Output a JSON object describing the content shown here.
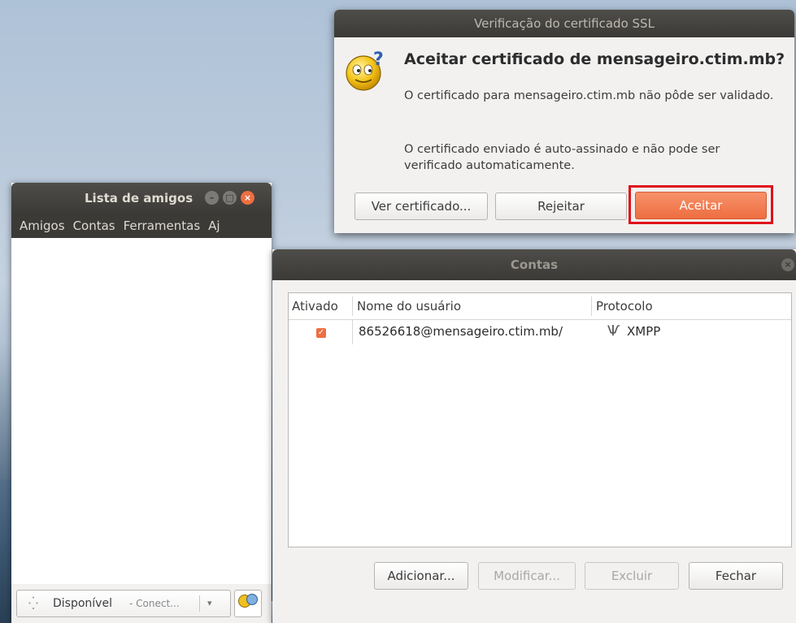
{
  "buddy_list": {
    "title": "Lista de amigos",
    "window_buttons": {
      "minimize": "–",
      "maximize": "□",
      "close": "×"
    },
    "menu": [
      "Amigos",
      "Contas",
      "Ferramentas",
      "Aj"
    ],
    "status": {
      "value": "Disponível",
      "detail": "- Conect...",
      "arrow": "▾",
      "spinner": "⁛"
    }
  },
  "accounts": {
    "title": "Contas",
    "close_glyph": "×",
    "columns": {
      "enabled": "Ativado",
      "username": "Nome do usuário",
      "protocol": "Protocolo"
    },
    "rows": [
      {
        "enabled": "✓",
        "username": "86526618@mensageiro.ctim.mb/",
        "protocol_icon": "Ѱ",
        "protocol": "XMPP"
      }
    ],
    "buttons": {
      "add": "Adicionar...",
      "modify": "Modificar...",
      "remove": "Excluir",
      "close": "Fechar"
    }
  },
  "ssl_dialog": {
    "title": "Verificação do certificado SSL",
    "heading": "Aceitar certificado de mensageiro.ctim.mb?",
    "message1": "O certificado para mensageiro.ctim.mb não pôde ser validado.",
    "message2": "O certificado enviado é auto-assinado e não pode ser verificado automaticamente.",
    "icon_glyph": "?",
    "buttons": {
      "view_certificate": "Ver certificado...",
      "reject": "Rejeitar",
      "accept": "Aceitar"
    }
  },
  "colors": {
    "accent": "#ee6e41",
    "highlight": "#e0101a",
    "titlebar": "#3b3a37"
  }
}
